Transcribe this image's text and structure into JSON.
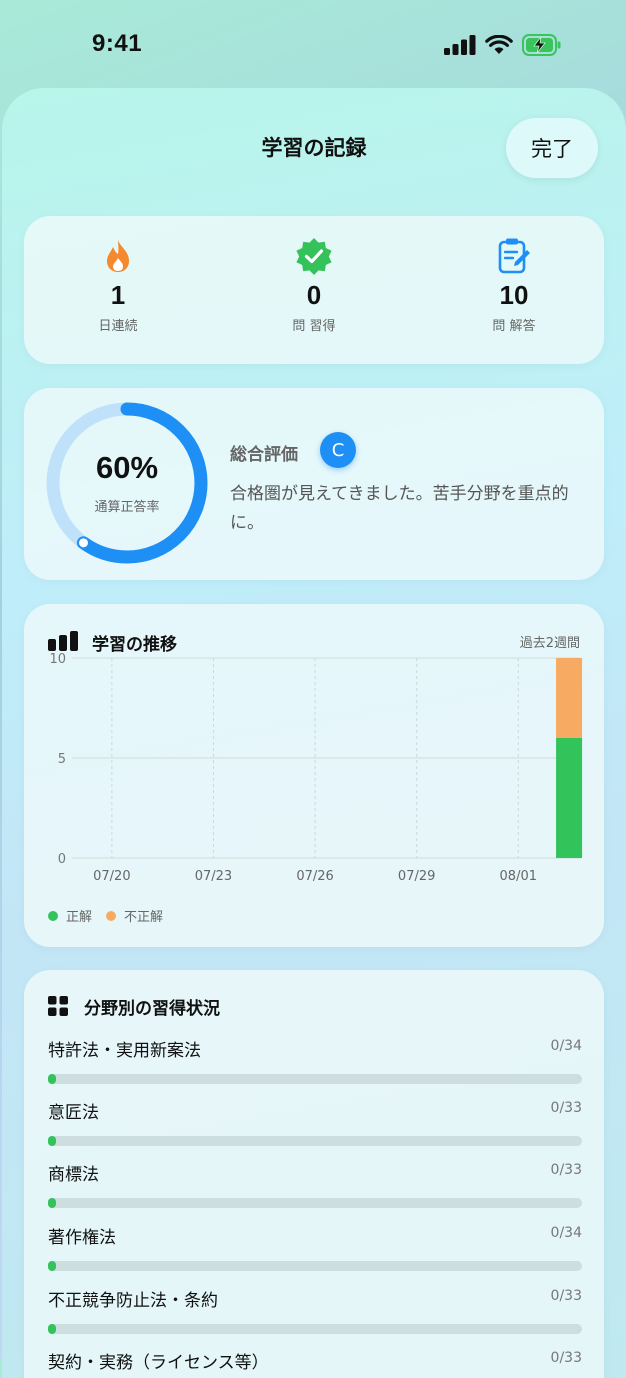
{
  "status_bar": {
    "time": "9:41"
  },
  "header": {
    "title": "学習の記録",
    "done_label": "完了"
  },
  "stats": [
    {
      "icon": "flame-icon",
      "value": "1",
      "label": "日連続",
      "color": "#f5892e"
    },
    {
      "icon": "verified-badge-icon",
      "value": "0",
      "label": "問 習得",
      "color": "#34c35a"
    },
    {
      "icon": "clipboard-edit-icon",
      "value": "10",
      "label": "問 解答",
      "color": "#1e8ff4"
    }
  ],
  "evaluation": {
    "percent": "60%",
    "percent_value": 60,
    "percent_label": "通算正答率",
    "title": "総合評価",
    "grade": "C",
    "message": "合格圏が見えてきました。苦手分野を重点的に。"
  },
  "trend": {
    "title": "学習の推移",
    "period": "過去2週間",
    "legend": [
      {
        "name": "正解",
        "color": "#33c35b"
      },
      {
        "name": "不正解",
        "color": "#f7ab62"
      }
    ]
  },
  "chart_data": {
    "type": "bar",
    "stacked": true,
    "x": [
      "07/19",
      "07/20",
      "07/21",
      "07/22",
      "07/23",
      "07/24",
      "07/25",
      "07/26",
      "07/27",
      "07/28",
      "07/29",
      "07/30",
      "07/31",
      "08/01",
      "08/02"
    ],
    "x_tick_labels": [
      "07/20",
      "07/23",
      "07/26",
      "07/29",
      "08/01"
    ],
    "series": [
      {
        "name": "正解",
        "color": "#33c35b",
        "values": [
          0,
          0,
          0,
          0,
          0,
          0,
          0,
          0,
          0,
          0,
          0,
          0,
          0,
          0,
          6
        ]
      },
      {
        "name": "不正解",
        "color": "#f7ab62",
        "values": [
          0,
          0,
          0,
          0,
          0,
          0,
          0,
          0,
          0,
          0,
          0,
          0,
          0,
          0,
          4
        ]
      }
    ],
    "y_ticks": [
      0,
      5,
      10
    ],
    "ylim": [
      0,
      10
    ],
    "grid": true
  },
  "categories": {
    "title": "分野別の習得状況",
    "items": [
      {
        "name": "特許法・実用新案法",
        "count": "0/34",
        "progress": 0
      },
      {
        "name": "意匠法",
        "count": "0/33",
        "progress": 0
      },
      {
        "name": "商標法",
        "count": "0/33",
        "progress": 0
      },
      {
        "name": "著作権法",
        "count": "0/34",
        "progress": 0
      },
      {
        "name": "不正競争防止法・条約",
        "count": "0/33",
        "progress": 0
      },
      {
        "name": "契約・実務（ライセンス等）",
        "count": "0/33",
        "progress": 0
      }
    ]
  }
}
